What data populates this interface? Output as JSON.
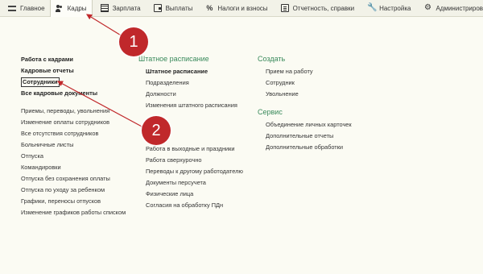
{
  "topbar": {
    "tabs": [
      {
        "label": "Главное",
        "icon": "menu-icon"
      },
      {
        "label": "Кадры",
        "icon": "people-icon",
        "active": true
      },
      {
        "label": "Зарплата",
        "icon": "calculator-icon"
      },
      {
        "label": "Выплаты",
        "icon": "wallet-icon"
      },
      {
        "label": "Налоги и взносы",
        "icon": "percent-icon"
      },
      {
        "label": "Отчетность, справки",
        "icon": "report-icon"
      },
      {
        "label": "Настройка",
        "icon": "wrench-icon"
      },
      {
        "label": "Администрирование",
        "icon": "gear-icon"
      }
    ]
  },
  "left": {
    "top_items": [
      "Работа с кадрами",
      "Кадровые отчеты",
      "Сотрудники",
      "Все кадровые документы"
    ],
    "items": [
      "Приемы, переводы, увольнения",
      "Изменение оплаты сотрудников",
      "Все отсутствия сотрудников",
      "Больничные листы",
      "Отпуска",
      "Командировки",
      "Отпуска без сохранения оплаты",
      "Отпуска по уходу за ребенком",
      "Графики, переносы отпусков",
      "Изменение графиков работы списком"
    ]
  },
  "middle": {
    "heading": "Штатное расписание",
    "items": [
      "Штатное расписание",
      "Подразделения",
      "Должности",
      "Изменения штатного расписания"
    ],
    "items2": [
      "Работа в выходные и праздники",
      "Работа сверхурочно",
      "Переводы к другому работодателю",
      "Документы персучета",
      "Физические лица",
      "Согласия на обработку ПДн"
    ]
  },
  "right": {
    "create_heading": "Создать",
    "create_items": [
      "Прием на работу",
      "Сотрудник",
      "Увольнение"
    ],
    "service_heading": "Сервис",
    "service_items": [
      "Объединение личных карточек",
      "Дополнительные отчеты",
      "Дополнительные обработки"
    ]
  },
  "markers": [
    "1",
    "2"
  ],
  "colors": {
    "accent_green": "#3a8a5c",
    "marker_red": "#c0282b"
  }
}
